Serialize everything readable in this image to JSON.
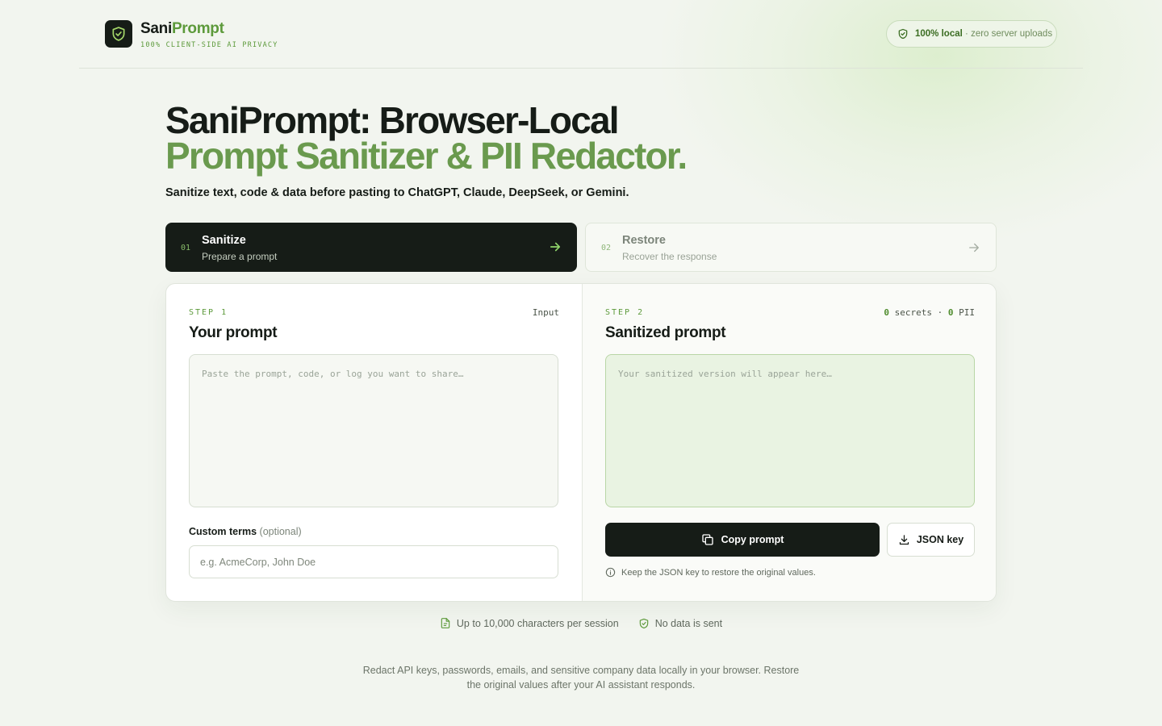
{
  "colors": {
    "accent": "#5d9a3b",
    "dark": "#161c17",
    "background": "#f2f5ef",
    "hero_accent": "#6a9a4e"
  },
  "header": {
    "brand_part1": "Sani",
    "brand_part2": "Prompt",
    "tagline": "100% CLIENT-SIDE AI PRIVACY",
    "logo_icon": "shield-check-icon",
    "badge": {
      "strong": "100% local",
      "sep": "·",
      "text": "zero server uploads",
      "icon": "shield-check-icon"
    }
  },
  "hero": {
    "title_line1": "SaniPrompt: Browser-Local",
    "title_line2": "Prompt Sanitizer & PII Redactor.",
    "subtitle": "Sanitize text, code & data before pasting to ChatGPT, Claude, DeepSeek, or Gemini."
  },
  "tabs": [
    {
      "num": "01",
      "title": "Sanitize",
      "desc": "Prepare a prompt",
      "active": true
    },
    {
      "num": "02",
      "title": "Restore",
      "desc": "Recover the response",
      "active": false
    }
  ],
  "input_pane": {
    "step": "STEP 1",
    "tag": "Input",
    "title": "Your prompt",
    "placeholder": "Paste the prompt, code, or log you want to share…",
    "value": "",
    "custom_terms_label": "Custom terms",
    "custom_terms_optional": "(optional)",
    "custom_terms_placeholder": "e.g. AcmeCorp, John Doe"
  },
  "output_pane": {
    "step": "STEP 2",
    "secrets_count": "0",
    "secrets_label": "secrets",
    "sep": "·",
    "pii_count": "0",
    "pii_label": "PII",
    "title": "Sanitized prompt",
    "placeholder": "Your sanitized version will appear here…",
    "copy_button": "Copy prompt",
    "json_button": "JSON key",
    "hint": "Keep the JSON key to restore the original values."
  },
  "features": [
    {
      "icon": "document-icon",
      "text": "Up to 10,000 characters per session"
    },
    {
      "icon": "shield-check-icon",
      "text": "No data is sent"
    }
  ],
  "footer": {
    "text": "Redact API keys, passwords, emails, and sensitive company data locally in your browser. Restore the original values after your AI assistant responds."
  }
}
